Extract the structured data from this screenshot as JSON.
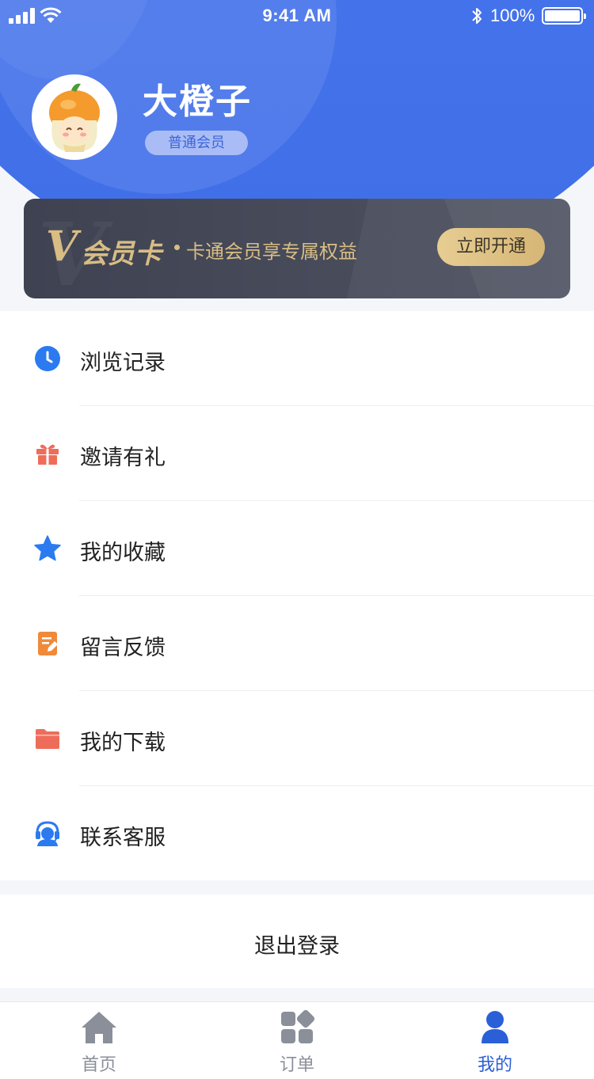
{
  "status_bar": {
    "time": "9:41 AM",
    "battery": "100%"
  },
  "profile": {
    "name": "大橙子",
    "member_level": "普通会员"
  },
  "vip_card": {
    "badge_letter": "V",
    "title": "会员卡",
    "description": "卡通会员享专属权益",
    "button_label": "立即开通",
    "colors": {
      "gold": "#d8bd84",
      "card_bg": "#434756"
    }
  },
  "menu": {
    "items": [
      {
        "label": "浏览记录",
        "icon": "clock-icon",
        "color": "#2b7af0"
      },
      {
        "label": "邀请有礼",
        "icon": "gift-icon",
        "color": "#ee6d5a"
      },
      {
        "label": "我的收藏",
        "icon": "star-icon",
        "color": "#2b7af0"
      },
      {
        "label": "留言反馈",
        "icon": "feedback-note-icon",
        "color": "#f08a3a"
      },
      {
        "label": "我的下载",
        "icon": "folder-icon",
        "color": "#ee6d5a"
      },
      {
        "label": "联系客服",
        "icon": "customer-service-icon",
        "color": "#2b7af0"
      }
    ]
  },
  "logout": {
    "label": "退出登录"
  },
  "tabbar": {
    "tabs": [
      {
        "label": "首页",
        "icon": "home-icon",
        "active": false
      },
      {
        "label": "订单",
        "icon": "grid-icon",
        "active": false
      },
      {
        "label": "我的",
        "icon": "user-icon",
        "active": true
      }
    ]
  },
  "colors": {
    "primary": "#4272ea",
    "tab_active": "#2a5fd8",
    "tab_inactive": "#8a8f99"
  }
}
